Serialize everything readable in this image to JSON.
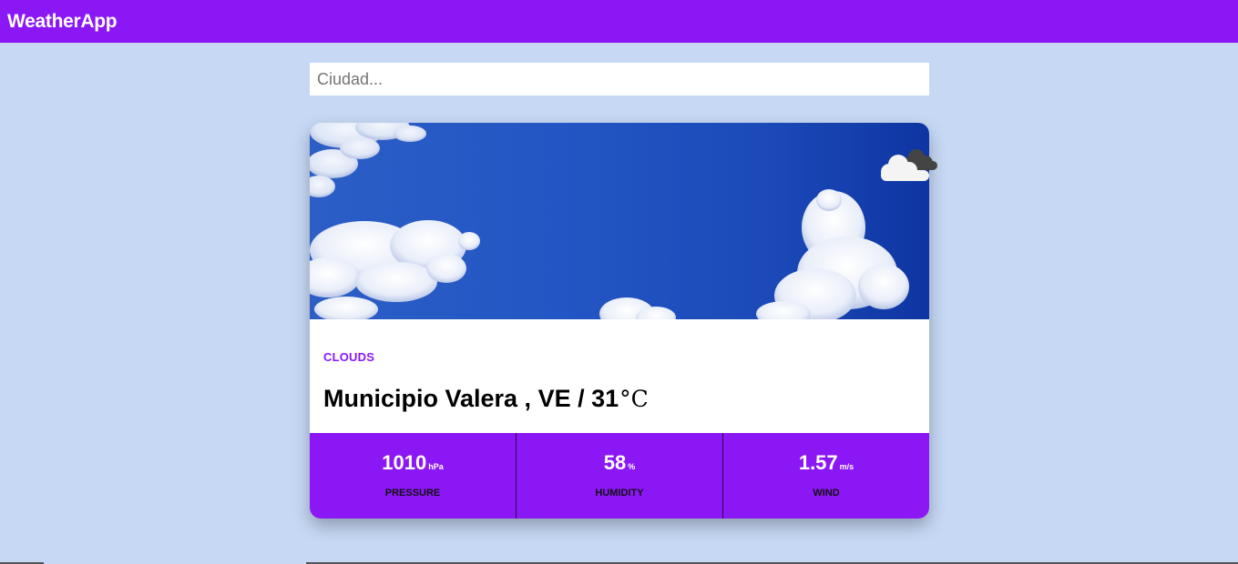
{
  "navbar": {
    "brand": "WeatherApp"
  },
  "search": {
    "placeholder": "Ciudad..."
  },
  "card": {
    "image": "cloudy-sky-photo",
    "weather_icon": "clouds-icon",
    "description": "CLOUDS",
    "location": "Municipio Valera , VE / 31",
    "temp_unit": "°C",
    "stats": [
      {
        "value": "1010",
        "unit": "hPa",
        "label": "PRESSURE"
      },
      {
        "value": "58",
        "unit": "%",
        "label": "HUMIDITY"
      },
      {
        "value": "1.57",
        "unit": "m/s",
        "label": "WIND"
      }
    ]
  },
  "colors": {
    "accent": "#8b17f5",
    "background": "#c6d8f4"
  }
}
